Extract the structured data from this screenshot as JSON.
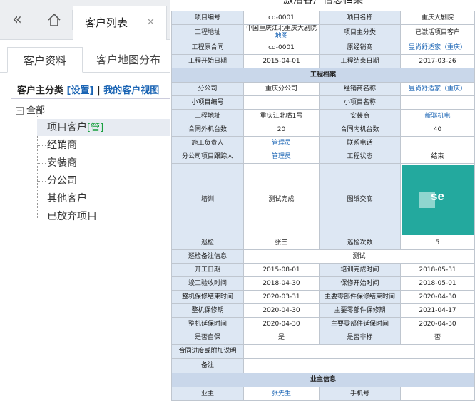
{
  "nav": {
    "back_icon": "double-chevron-left-icon",
    "home_icon": "home-icon",
    "tab_label": "客户列表",
    "close_glyph": "×"
  },
  "subtabs": [
    "客户资料",
    "客户地图分布"
  ],
  "sidebar": {
    "heading": "客户主分类",
    "settings_link": "[设置]",
    "separator": "|",
    "my_view_link": "我的客户视图",
    "root": "全部",
    "root_toggle": "⊟",
    "items": [
      {
        "label": "项目客户",
        "tag": "[管]"
      },
      {
        "label": "经销商"
      },
      {
        "label": "安装商"
      },
      {
        "label": "分公司"
      },
      {
        "label": "其他客户"
      },
      {
        "label": "已放弃项目"
      }
    ]
  },
  "archive": {
    "title": "激活客户信息档案",
    "top_rows": [
      [
        "项目编号",
        "cq-0001",
        "项目名称",
        "重庆大剧院"
      ],
      [
        "工程地址",
        "中国重庆江北重庆大剧院",
        "项目主分类",
        "已激活项目客户"
      ],
      [
        "工程原合同",
        "cq-0001",
        "原经销商",
        "昱尚舒适家（重庆）"
      ],
      [
        "工程开始日期",
        "2015-04-01",
        "工程结束日期",
        "2017-03-26"
      ]
    ],
    "address_map_link": "地图",
    "section_engineering": "工程档案",
    "eng_rows": [
      [
        "分公司",
        "重庆分公司",
        "经销商名称",
        "昱尚舒适家（重庆）"
      ],
      [
        "小项目编号",
        "",
        "小项目名称",
        ""
      ],
      [
        "工程地址",
        "重庆江北嘴1号",
        "安装商",
        "新驱机电"
      ],
      [
        "合同外机台数",
        "20",
        "合同内机台数",
        "40"
      ],
      [
        "施工负责人",
        "管理员",
        "联系电话",
        ""
      ],
      [
        "分公司项目跟踪人",
        "管理员",
        "工程状态",
        "结束"
      ]
    ],
    "training_row": [
      "培训",
      "测试完成",
      "图纸交底"
    ],
    "photo_text": "se",
    "inspection_row": [
      "巡检",
      "张三",
      "巡检次数",
      "5"
    ],
    "inspection_note": [
      "巡检备注信息",
      "测试"
    ],
    "date_rows": [
      [
        "开工日期",
        "2015-08-01",
        "培训完成时间",
        "2018-05-31"
      ],
      [
        "竣工验收时间",
        "2018-04-30",
        "保修开始时间",
        "2018-05-01"
      ],
      [
        "整机保修结束时间",
        "2020-03-31",
        "主要零部件保修结束时间",
        "2020-04-30"
      ],
      [
        "整机保修期",
        "2020-04-30",
        "主要零部件保修期",
        "2021-04-17"
      ],
      [
        "整机延保时间",
        "2020-04-30",
        "主要零部件延保时间",
        "2020-04-30"
      ],
      [
        "是否自保",
        "是",
        "是否非标",
        "否"
      ]
    ],
    "contract_note_label": "合同进度或附加说明",
    "remarks_label": "备注",
    "section_owner": "业主信息",
    "owner_row": [
      "业主",
      "张先生",
      "手机号",
      ""
    ]
  },
  "colors": {
    "accent_link": "#1a64b4",
    "key_cell_bg": "#dde7f3",
    "section_bg": "#c9d7ea",
    "photo_bg": "#23a99e",
    "tag_green": "#1aa040"
  }
}
